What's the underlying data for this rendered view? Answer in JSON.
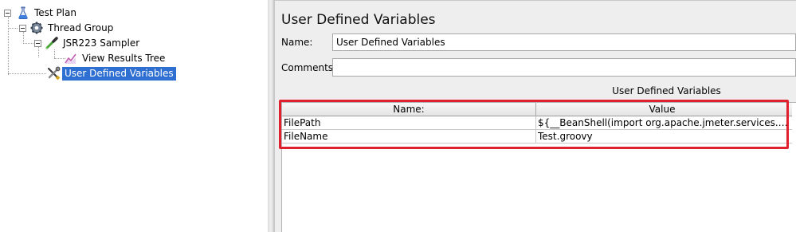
{
  "tree": {
    "test_plan": "Test Plan",
    "thread_group": "Thread Group",
    "sampler": "JSR223 Sampler",
    "results": "View Results Tree",
    "udv": "User Defined Variables"
  },
  "panel": {
    "title": "User Defined Variables",
    "name_label": "Name:",
    "name_value": "User Defined Variables",
    "comments_label": "Comments:",
    "comments_value": "",
    "table_caption": "User Defined Variables"
  },
  "table": {
    "headers": [
      "Name:",
      "Value"
    ],
    "rows": [
      [
        "FilePath",
        "${__BeanShell(import org.apache.jmeter.services.FileServer..."
      ],
      [
        "FileName",
        "Test.groovy"
      ]
    ]
  },
  "colors": {
    "selection": "#2f6fd1",
    "highlight": "#e0202c"
  },
  "icons": {
    "test_plan": "flask-icon",
    "thread_group": "gear-icon",
    "sampler": "pipette-icon",
    "results": "chart-icon",
    "udv": "wrench-screwdriver-icon"
  }
}
